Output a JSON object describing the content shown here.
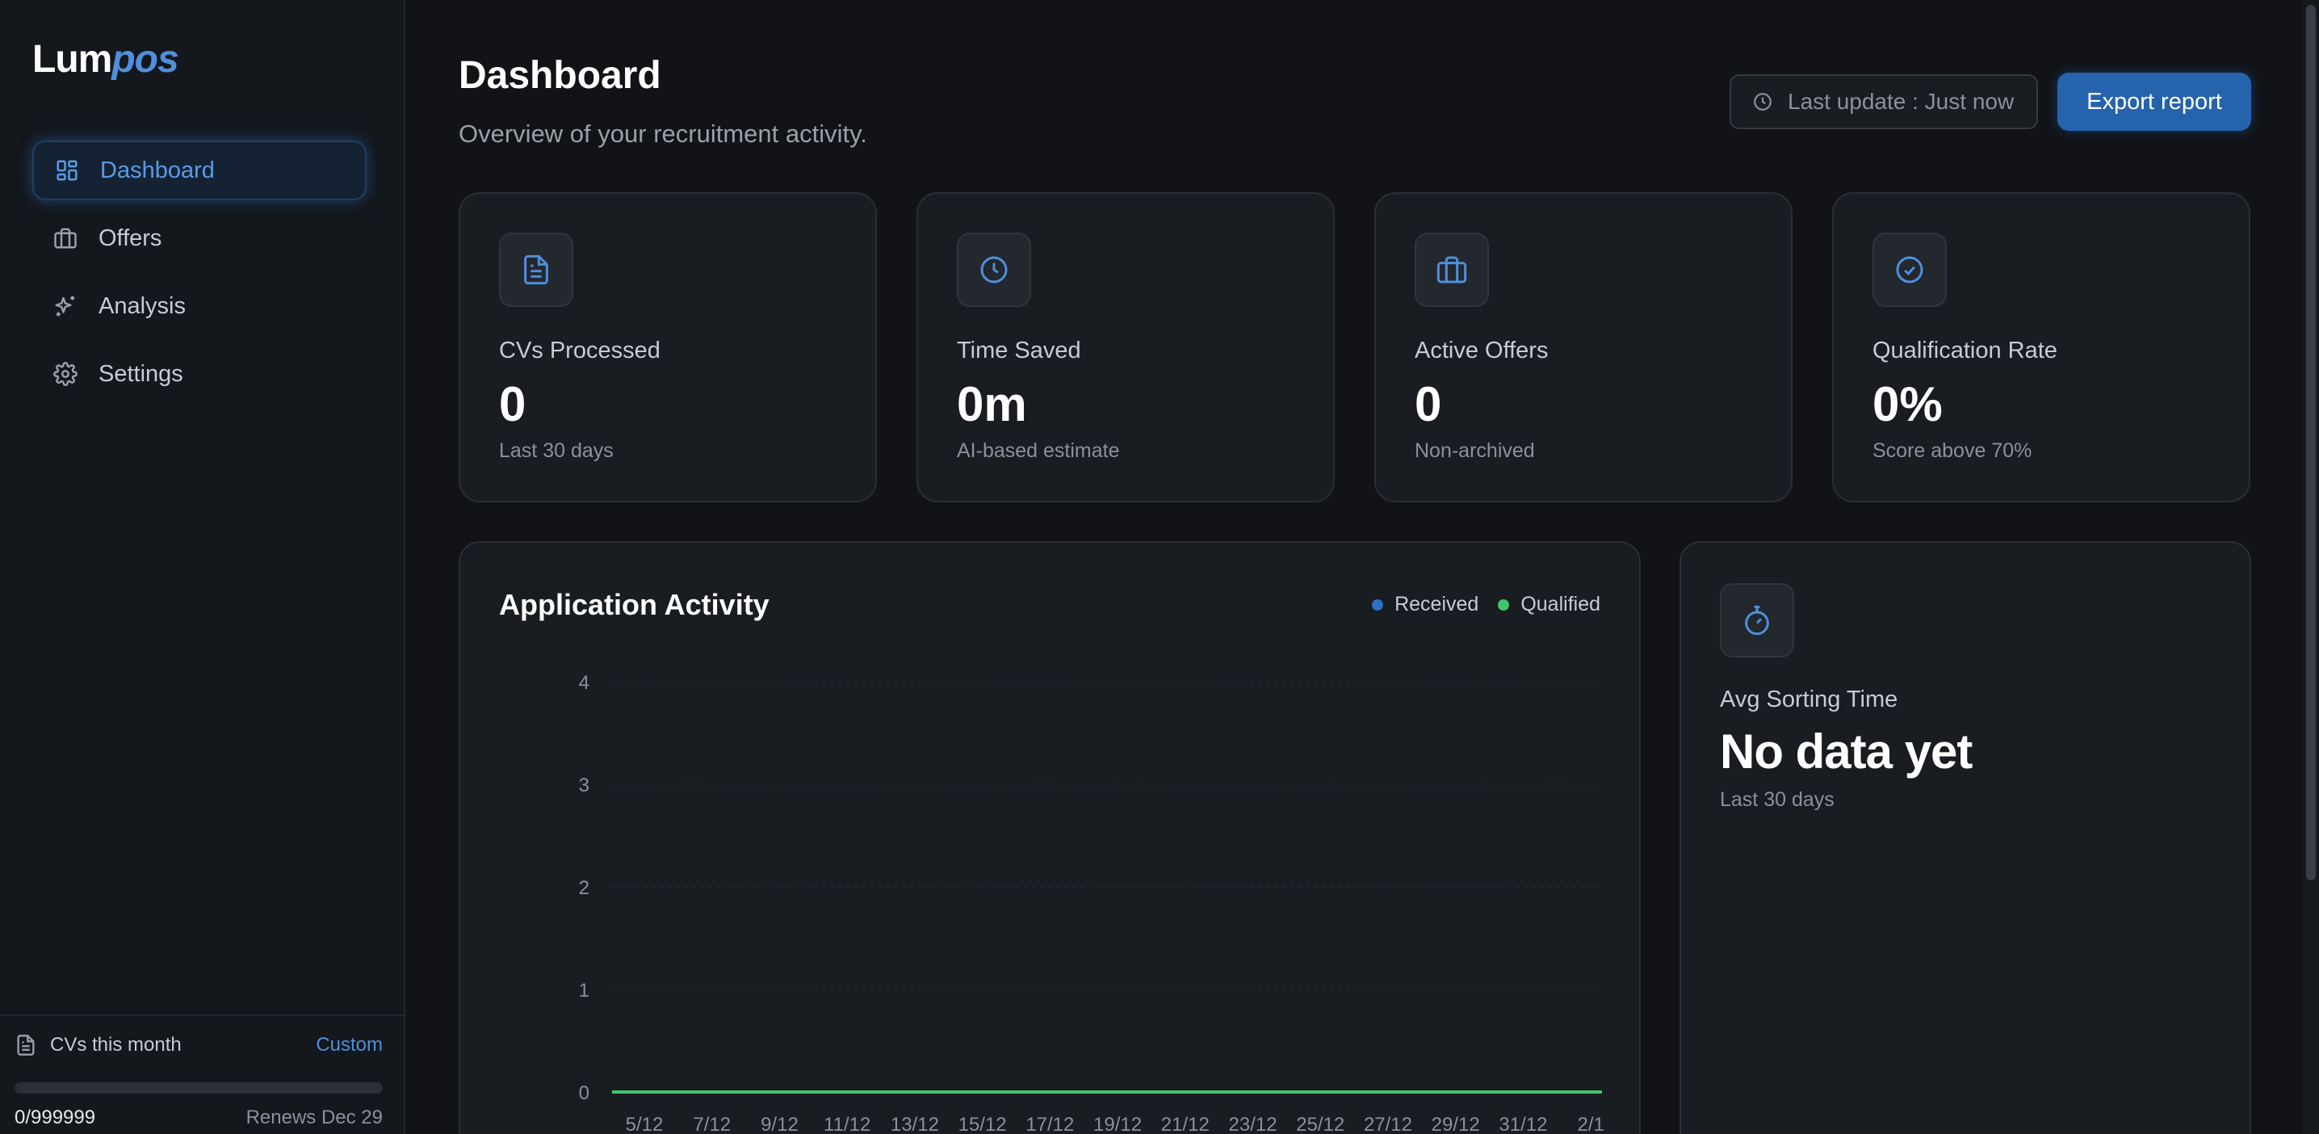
{
  "app": {
    "logo_part1": "Lum",
    "logo_part2": "pos"
  },
  "sidebar": {
    "items": [
      {
        "label": "Dashboard",
        "icon": "dashboard-grid-icon",
        "active": true
      },
      {
        "label": "Offers",
        "icon": "briefcase-icon",
        "active": false
      },
      {
        "label": "Analysis",
        "icon": "sparkles-icon",
        "active": false
      },
      {
        "label": "Settings",
        "icon": "gear-icon",
        "active": false
      }
    ],
    "usage": {
      "label": "CVs this month",
      "plan": "Custom",
      "count": "0/999999",
      "renews": "Renews Dec 29",
      "progress": 0
    }
  },
  "header": {
    "title": "Dashboard",
    "subtitle": "Overview of your recruitment activity.",
    "last_update": "Last update : Just now",
    "export_label": "Export report"
  },
  "stats": [
    {
      "label": "CVs Processed",
      "value": "0",
      "sub": "Last 30 days",
      "icon": "document-icon"
    },
    {
      "label": "Time Saved",
      "value": "0m",
      "sub": "AI-based estimate",
      "icon": "clock-icon"
    },
    {
      "label": "Active Offers",
      "value": "0",
      "sub": "Non-archived",
      "icon": "briefcase-icon"
    },
    {
      "label": "Qualification Rate",
      "value": "0%",
      "sub": "Score above 70%",
      "icon": "check-circle-icon"
    }
  ],
  "avg_sorting": {
    "label": "Avg Sorting Time",
    "value": "No data yet",
    "sub": "Last 30 days",
    "icon": "stopwatch-icon"
  },
  "colors": {
    "accent": "#4f8fdc",
    "received": "#2f6fc4",
    "qualified": "#3fc66a",
    "background": "#111317",
    "card": "#191c21"
  },
  "chart_data": {
    "type": "line",
    "title": "Application Activity",
    "x": [
      "5/12",
      "7/12",
      "9/12",
      "11/12",
      "13/12",
      "15/12",
      "17/12",
      "19/12",
      "21/12",
      "23/12",
      "25/12",
      "27/12",
      "29/12",
      "31/12",
      "2/1"
    ],
    "series": [
      {
        "name": "Received",
        "values": [
          0,
          0,
          0,
          0,
          0,
          0,
          0,
          0,
          0,
          0,
          0,
          0,
          0,
          0,
          0
        ]
      },
      {
        "name": "Qualified",
        "values": [
          0,
          0,
          0,
          0,
          0,
          0,
          0,
          0,
          0,
          0,
          0,
          0,
          0,
          0,
          0
        ]
      }
    ],
    "yticks": [
      0,
      1,
      2,
      3,
      4
    ],
    "ylim": [
      0,
      4
    ],
    "legend": "top-right",
    "grid": true
  }
}
